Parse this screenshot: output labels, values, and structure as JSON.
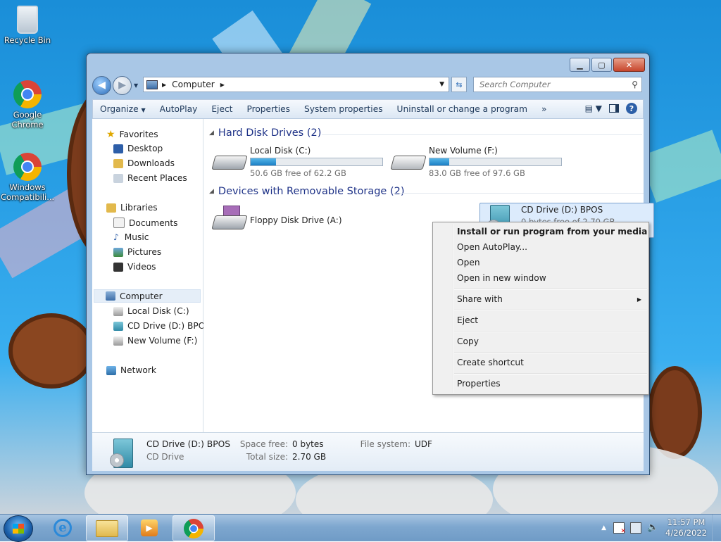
{
  "desktop": {
    "icons": [
      {
        "label": "Recycle Bin"
      },
      {
        "label": "Google Chrome"
      },
      {
        "label": "Windows Compatibili..."
      }
    ]
  },
  "window": {
    "address": {
      "crumb": "Computer"
    },
    "search": {
      "placeholder": "Search Computer"
    },
    "toolbar": {
      "organize": "Organize",
      "autoplay": "AutoPlay",
      "eject": "Eject",
      "properties": "Properties",
      "system_properties": "System properties",
      "uninstall": "Uninstall or change a program",
      "more": "»"
    },
    "nav": {
      "favorites": "Favorites",
      "desktop": "Desktop",
      "downloads": "Downloads",
      "recent": "Recent Places",
      "libraries": "Libraries",
      "documents": "Documents",
      "music": "Music",
      "pictures": "Pictures",
      "videos": "Videos",
      "computer": "Computer",
      "local_c": "Local Disk (C:)",
      "cd_d": "CD Drive (D:) BPOS",
      "new_f": "New Volume (F:)",
      "network": "Network"
    },
    "groups": {
      "hdd": "Hard Disk Drives (2)",
      "removable": "Devices with Removable Storage (2)"
    },
    "drives": {
      "c": {
        "name": "Local Disk (C:)",
        "free": "50.6 GB free of 62.2 GB",
        "used_fraction": 0.19
      },
      "f": {
        "name": "New Volume (F:)",
        "free": "83.0 GB free of 97.6 GB",
        "used_fraction": 0.15
      },
      "a": {
        "name": "Floppy Disk Drive (A:)"
      },
      "d": {
        "name": "CD Drive (D:) BPOS",
        "free": "0 bytes free of 2.70 GB"
      }
    },
    "details": {
      "name": "CD Drive (D:) BPOS",
      "type": "CD Drive",
      "space_free_label": "Space free:",
      "space_free": "0 bytes",
      "total_size_label": "Total size:",
      "total_size": "2.70 GB",
      "file_system_label": "File system:",
      "file_system": "UDF"
    }
  },
  "context_menu": {
    "install": "Install or run program from your media",
    "open_autoplay": "Open AutoPlay...",
    "open": "Open",
    "open_new_window": "Open in new window",
    "share_with": "Share with",
    "eject": "Eject",
    "copy": "Copy",
    "create_shortcut": "Create shortcut",
    "properties": "Properties"
  },
  "taskbar": {
    "time": "11:57 PM",
    "date": "4/26/2022"
  }
}
